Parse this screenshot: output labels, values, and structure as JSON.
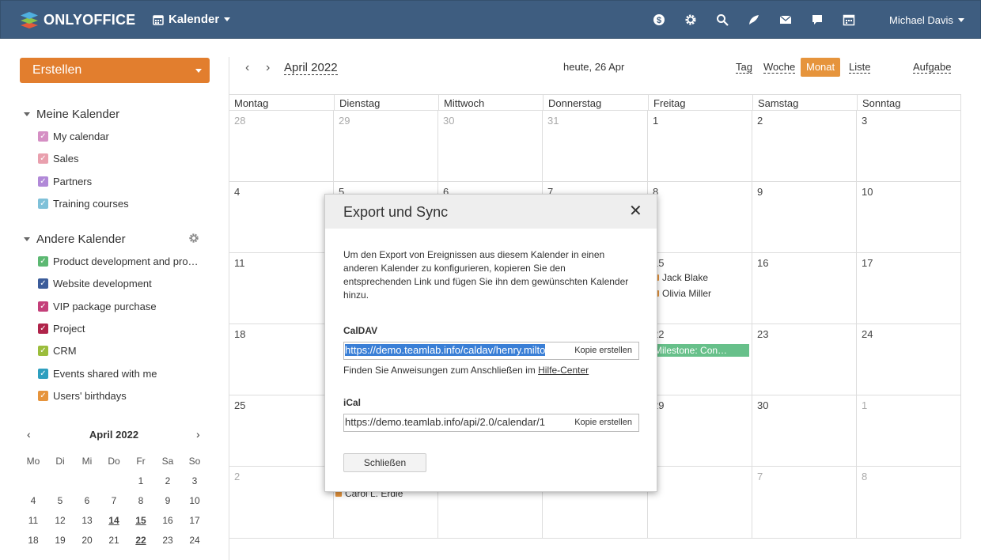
{
  "header": {
    "brand": "ONLYOFFICE",
    "module_label": "Kalender",
    "user_name": "Michael Davis",
    "icons": [
      "currency-icon",
      "gear-icon",
      "search-icon",
      "feed-icon",
      "mail-icon",
      "chat-icon",
      "calendar-icon"
    ]
  },
  "sidebar": {
    "create_label": "Erstellen",
    "my_calendars_title": "Meine Kalender",
    "my_calendars": [
      {
        "label": "My calendar",
        "color": "#d58fc4"
      },
      {
        "label": "Sales",
        "color": "#e9a0ae"
      },
      {
        "label": "Partners",
        "color": "#b189d8"
      },
      {
        "label": "Training courses",
        "color": "#7fc1d9"
      }
    ],
    "other_calendars_title": "Andere Kalender",
    "other_calendars": [
      {
        "label": "Product development and pro…",
        "color": "#5cb872"
      },
      {
        "label": "Website development",
        "color": "#3b5c9a"
      },
      {
        "label": "VIP package purchase",
        "color": "#c4407a"
      },
      {
        "label": "Project",
        "color": "#b0244a"
      },
      {
        "label": "CRM",
        "color": "#9bbd3c"
      },
      {
        "label": "Events shared with me",
        "color": "#2e9fbf"
      },
      {
        "label": "Users' birthdays",
        "color": "#e6943c"
      }
    ]
  },
  "mini_calendar": {
    "title": "April 2022",
    "weekdays": [
      "Mo",
      "Di",
      "Mi",
      "Do",
      "Fr",
      "Sa",
      "So"
    ],
    "rows": [
      [
        "",
        "",
        "",
        "",
        "1",
        "2",
        "3"
      ],
      [
        "4",
        "5",
        "6",
        "7",
        "8",
        "9",
        "10"
      ],
      [
        "11",
        "12",
        "13",
        "14",
        "15",
        "16",
        "17"
      ],
      [
        "18",
        "19",
        "20",
        "21",
        "22",
        "23",
        "24"
      ]
    ]
  },
  "toolbar": {
    "month_title": "April 2022",
    "today_label": "heute, 26 Apr",
    "views": [
      "Tag",
      "Woche",
      "Monat",
      "Liste"
    ],
    "active_view": "Monat",
    "task_label": "Aufgabe"
  },
  "calendar": {
    "weekdays": [
      "Montag",
      "Dienstag",
      "Mittwoch",
      "Donnerstag",
      "Freitag",
      "Samstag",
      "Sonntag"
    ],
    "weeks": [
      [
        "28",
        "29",
        "30",
        "31",
        "1",
        "2",
        "3"
      ],
      [
        "4",
        "5",
        "6",
        "7",
        "8",
        "9",
        "10"
      ],
      [
        "11",
        "",
        "",
        "",
        "15",
        "16",
        "17"
      ],
      [
        "18",
        "",
        "",
        "",
        "22",
        "23",
        "24"
      ],
      [
        "25",
        "",
        "",
        "",
        "29",
        "30",
        "1"
      ],
      [
        "2",
        "",
        "",
        "",
        "",
        "7",
        "8"
      ]
    ],
    "events": {
      "jack": "Jack Blake",
      "olivia": "Olivia Miller",
      "milestone": "Milestone: Con…",
      "carol": "Carol L. Erdle"
    }
  },
  "dialog": {
    "title": "Export und Sync",
    "description": "Um den Export von Ereignissen aus diesem Kalender in einen anderen Kalender zu konfigurieren, kopieren Sie den entsprechenden Link und fügen Sie ihn dem gewünschten Kalender hinzu.",
    "caldav_label": "CalDAV",
    "caldav_value": "https://demo.teamlab.info/caldav/henry.milto",
    "copy_label": "Kopie erstellen",
    "hint_text": "Finden Sie Anweisungen zum Anschließen im ",
    "hint_link": "Hilfe-Center",
    "ical_label": "iCal",
    "ical_value": "https://demo.teamlab.info/api/2.0/calendar/1",
    "close_button": "Schließen"
  }
}
